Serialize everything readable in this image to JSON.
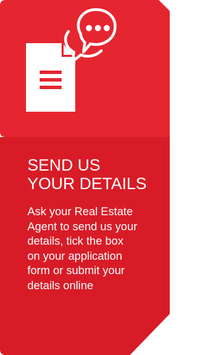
{
  "colors": {
    "top_panel": "#e52630",
    "bottom_panel": "#d71c27",
    "icon_white": "#ffffff"
  },
  "icons": {
    "document": "document-icon",
    "chat": "chat-bubble-icon"
  },
  "heading_lines": [
    "SEND US",
    "YOUR DETAILS"
  ],
  "body_lines": [
    "Ask your Real Estate",
    "Agent to send us your",
    "details, tick the box",
    "on your application",
    "form or submit your",
    "details online"
  ]
}
